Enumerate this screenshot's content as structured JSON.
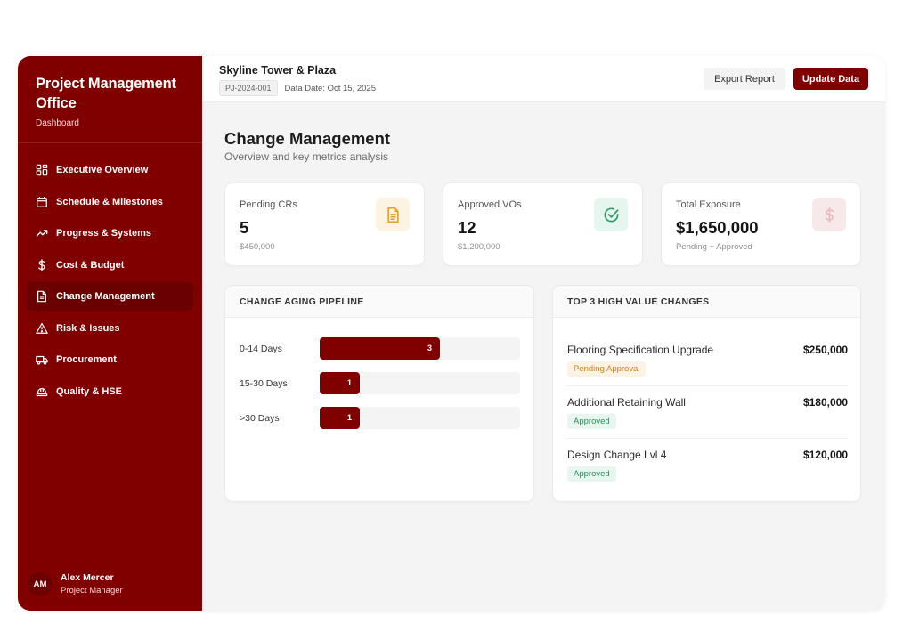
{
  "brand": {
    "title": "Project Management Office",
    "subtitle": "Dashboard"
  },
  "nav": [
    {
      "label": "Executive Overview",
      "icon": "grid-icon",
      "active": false
    },
    {
      "label": "Schedule & Milestones",
      "icon": "calendar-icon",
      "active": false
    },
    {
      "label": "Progress & Systems",
      "icon": "trending-up-icon",
      "active": false
    },
    {
      "label": "Cost & Budget",
      "icon": "dollar-icon",
      "active": false
    },
    {
      "label": "Change Management",
      "icon": "document-icon",
      "active": true
    },
    {
      "label": "Risk & Issues",
      "icon": "warning-icon",
      "active": false
    },
    {
      "label": "Procurement",
      "icon": "truck-icon",
      "active": false
    },
    {
      "label": "Quality & HSE",
      "icon": "hard-hat-icon",
      "active": false
    }
  ],
  "user": {
    "initials": "AM",
    "name": "Alex Mercer",
    "role": "Project Manager"
  },
  "header": {
    "project_name": "Skyline Tower & Plaza",
    "project_code": "PJ-2024-001",
    "data_date": "Data Date: Oct 15, 2025",
    "export_label": "Export Report",
    "update_label": "Update Data"
  },
  "page": {
    "title": "Change Management",
    "subtitle": "Overview and key metrics analysis"
  },
  "kpis": [
    {
      "label": "Pending CRs",
      "value": "5",
      "sub": "$450,000",
      "icon": "document-icon",
      "icon_color": "#e0a020",
      "icon_bg": "#fdf3e3"
    },
    {
      "label": "Approved VOs",
      "value": "12",
      "sub": "$1,200,000",
      "icon": "check-circle-icon",
      "icon_color": "#2c9a63",
      "icon_bg": "#e6f6ee"
    },
    {
      "label": "Total Exposure",
      "value": "$1,650,000",
      "sub": "Pending + Approved",
      "icon": "dollar-icon",
      "icon_color": "#e9bcbc",
      "icon_bg": "#f7e9e9"
    }
  ],
  "aging": {
    "title": "CHANGE AGING PIPELINE",
    "rows": [
      {
        "label": "0-14 Days",
        "count": "3",
        "share": 0.6
      },
      {
        "label": "15-30 Days",
        "count": "1",
        "share": 0.2
      },
      {
        "label": ">30 Days",
        "count": "1",
        "share": 0.2
      }
    ]
  },
  "top_changes": {
    "title": "TOP 3 HIGH VALUE CHANGES",
    "rows": [
      {
        "name": "Flooring Specification Upgrade",
        "amount": "$250,000",
        "status": "Pending Approval",
        "status_type": "pending"
      },
      {
        "name": "Additional Retaining Wall",
        "amount": "$180,000",
        "status": "Approved",
        "status_type": "approved"
      },
      {
        "name": "Design Change Lvl 4",
        "amount": "$120,000",
        "status": "Approved",
        "status_type": "approved"
      }
    ]
  },
  "colors": {
    "brand": "#800000",
    "brand_dark": "#6a0000"
  }
}
